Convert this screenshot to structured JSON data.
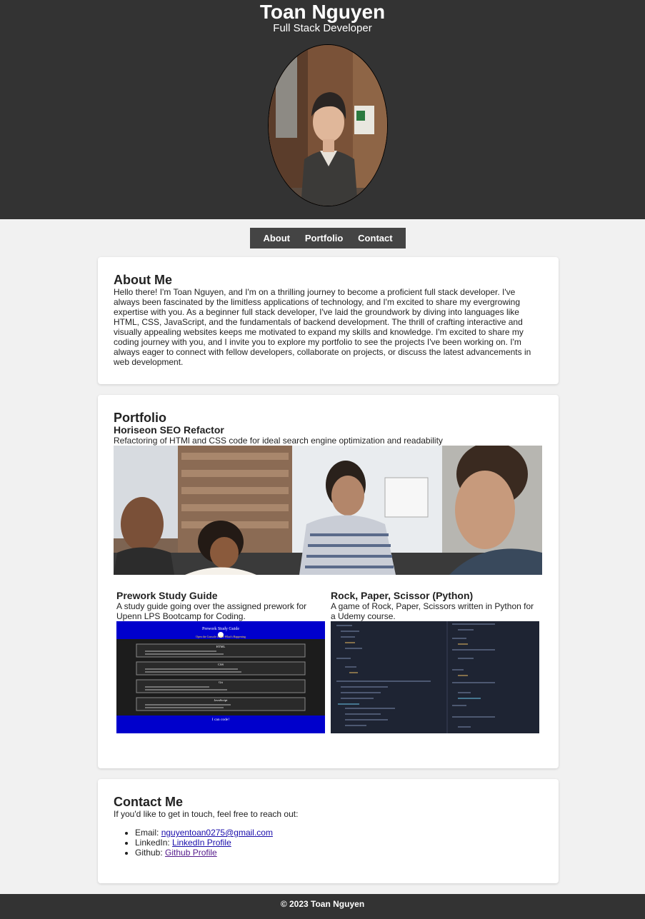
{
  "header": {
    "name": "Toan Nguyen",
    "role": "Full Stack Developer"
  },
  "nav": {
    "items": [
      "About",
      "Portfolio",
      "Contact"
    ]
  },
  "about": {
    "title": "About Me",
    "text": "Hello there! I'm Toan Nguyen, and I'm on a thrilling journey to become a proficient full stack developer. I've always been fascinated by the limitless applications of technology, and I'm excited to share my evergrowing expertise with you. As a beginner full stack developer, I've laid the groundwork by diving into languages like HTML, CSS, JavaScript, and the fundamentals of backend development. The thrill of crafting interactive and visually appealing websites keeps me motivated to expand my skills and knowledge. I'm excited to share my coding journey with you, and I invite you to explore my portfolio to see the projects I've been working on. I'm always eager to connect with fellow developers, collaborate on projects, or discuss the latest advancements in web development."
  },
  "portfolio": {
    "title": "Portfolio",
    "projects": [
      {
        "title": "Horiseon SEO Refactor",
        "desc": "Refactoring of HTMl and CSS code for ideal search engine optimization and readability"
      },
      {
        "title": "Prework Study Guide",
        "desc": "A study guide going over the assigned prework for Upenn LPS Bootcamp for Coding."
      },
      {
        "title": "Rock, Paper, Scissor (Python)",
        "desc": "A game of Rock, Paper, Scissors written in Python for a Udemy course."
      }
    ],
    "prework_thumb": {
      "heading": "Prework Study Guide",
      "console_note": "Open the Console to See What's Happening",
      "sections": [
        "HTML",
        "CSS",
        "Git",
        "JavaScript"
      ],
      "footer": "I can code!"
    }
  },
  "contact": {
    "title": "Contact Me",
    "intro": "If you'd like to get in touch, feel free to reach out:",
    "items": [
      {
        "label": "Email: ",
        "link": "nguyentoan0275@gmail.com"
      },
      {
        "label": "LinkedIn: ",
        "link": "LinkedIn Profile"
      },
      {
        "label": "Github: ",
        "link": "Github Profile"
      }
    ]
  },
  "footer": {
    "text": "© 2023 Toan Nguyen"
  },
  "colors": {
    "header_bg": "#333333",
    "nav_bg": "#444444",
    "page_bg": "#f1f1f1",
    "link": "#1a0dab",
    "prework_blue": "#0000cc",
    "code_bg": "#1e2433"
  }
}
